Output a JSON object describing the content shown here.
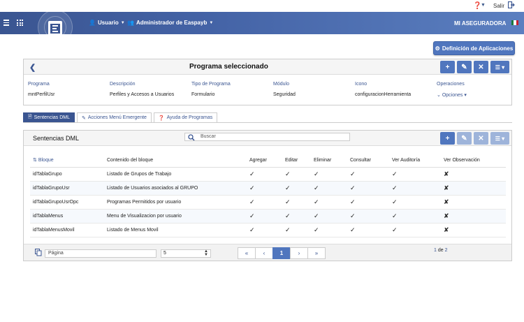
{
  "topbar": {
    "salir": "Salir"
  },
  "header": {
    "usuario": "Usuario",
    "admin": "Administrador de Easpayb",
    "brand": "MI ASEGURADORA"
  },
  "def_button": "Definición de Aplicaciones",
  "program_panel": {
    "title": "Programa seleccionado",
    "columns": [
      {
        "label": "Programa",
        "value": "mntPerfilUsr"
      },
      {
        "label": "Descripción",
        "value": "Perfiles y Accesos a Usuarios"
      },
      {
        "label": "Tipo de Programa",
        "value": "Formulario"
      },
      {
        "label": "Módulo",
        "value": "Seguridad"
      },
      {
        "label": "Icono",
        "value": "configuracionHerramienta"
      },
      {
        "label": "Operaciones",
        "value": "Opciones"
      }
    ]
  },
  "tabs": [
    "Sentencias DML",
    "Acciones Menú Emergente",
    "Ayuda de Programas"
  ],
  "dml_panel": {
    "title": "Sentencias DML",
    "search_placeholder": "Buscar",
    "headers": [
      "Bloque",
      "Contenido del bloque",
      "Agregar",
      "Editar",
      "Eliminar",
      "Consultar",
      "Ver Auditoría",
      "Ver Observación"
    ],
    "rows": [
      {
        "bloque": "idTablaGrupo",
        "contenido": "Listado de Grupos de Trabajo",
        "agregar": "✓",
        "editar": "✓",
        "eliminar": "✓",
        "consultar": "✓",
        "auditoria": "✓",
        "observacion": "✘"
      },
      {
        "bloque": "idTablaGrupoUsr",
        "contenido": "Listado de Usuarios asociados al GRUPO",
        "agregar": "✓",
        "editar": "✓",
        "eliminar": "✓",
        "consultar": "✓",
        "auditoria": "✓",
        "observacion": "✘"
      },
      {
        "bloque": "idTablaGrupoUsrOpc",
        "contenido": "Programas Permitidos por usuario",
        "agregar": "✓",
        "editar": "✓",
        "eliminar": "✓",
        "consultar": "✓",
        "auditoria": "✓",
        "observacion": "✘"
      },
      {
        "bloque": "idTablaMenus",
        "contenido": "Menu de Visualizacion por usuario",
        "agregar": "✓",
        "editar": "✓",
        "eliminar": "✓",
        "consultar": "✓",
        "auditoria": "✓",
        "observacion": "✘"
      },
      {
        "bloque": "idTablaMenusMovil",
        "contenido": "Listado de Menus Movil",
        "agregar": "✓",
        "editar": "✓",
        "eliminar": "✓",
        "consultar": "✓",
        "auditoria": "✓",
        "observacion": "✘"
      }
    ]
  },
  "pager": {
    "page_placeholder": "Página",
    "page_size": "5",
    "nav": [
      "«",
      "‹",
      "1",
      "›",
      "»"
    ],
    "info_current": "1",
    "info_of": "de",
    "info_total": "2"
  },
  "colors": {
    "primary": "#3a5591",
    "button": "#5076be",
    "header_end": "#5b7fc0"
  }
}
